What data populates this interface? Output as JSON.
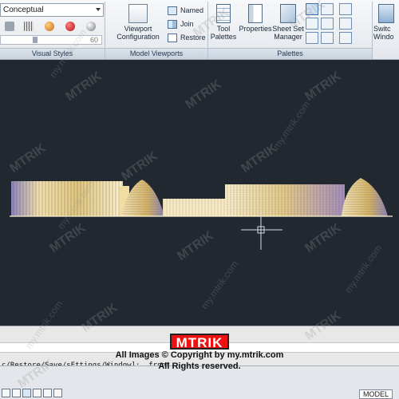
{
  "ribbon": {
    "visual_styles": {
      "combo_value": "Conceptual",
      "slider_value": "60",
      "title": "Visual Styles"
    },
    "model_viewports": {
      "viewport_label": "Viewport\nConfiguration",
      "named": "Named",
      "join": "Join",
      "restore": "Restore",
      "title": "Model Viewports"
    },
    "palettes": {
      "tool_palettes": "Tool\nPalettes",
      "properties": "Properties",
      "sheet_set": "Sheet Set\nManager",
      "title": "Palettes"
    },
    "windows": {
      "switch_windows": "Switc\nWindo"
    }
  },
  "command": {
    "history": "c/Restore/Save/sEttings/Window]: _front"
  },
  "status": {
    "model_tab": "MODEL"
  },
  "overlay": {
    "logo": "MTRIK",
    "line1": "All Images © Copyright by my.mtrik.com",
    "line2": "All Rights reserved.",
    "watermark_brand": "MTRIK",
    "watermark_url": "my.mtrik.com"
  },
  "colors": {
    "canvas_bg": "#212830",
    "building_light": "#f3e2a8",
    "building_mid": "#e0c77b",
    "building_shadow": "#8c83b8"
  }
}
